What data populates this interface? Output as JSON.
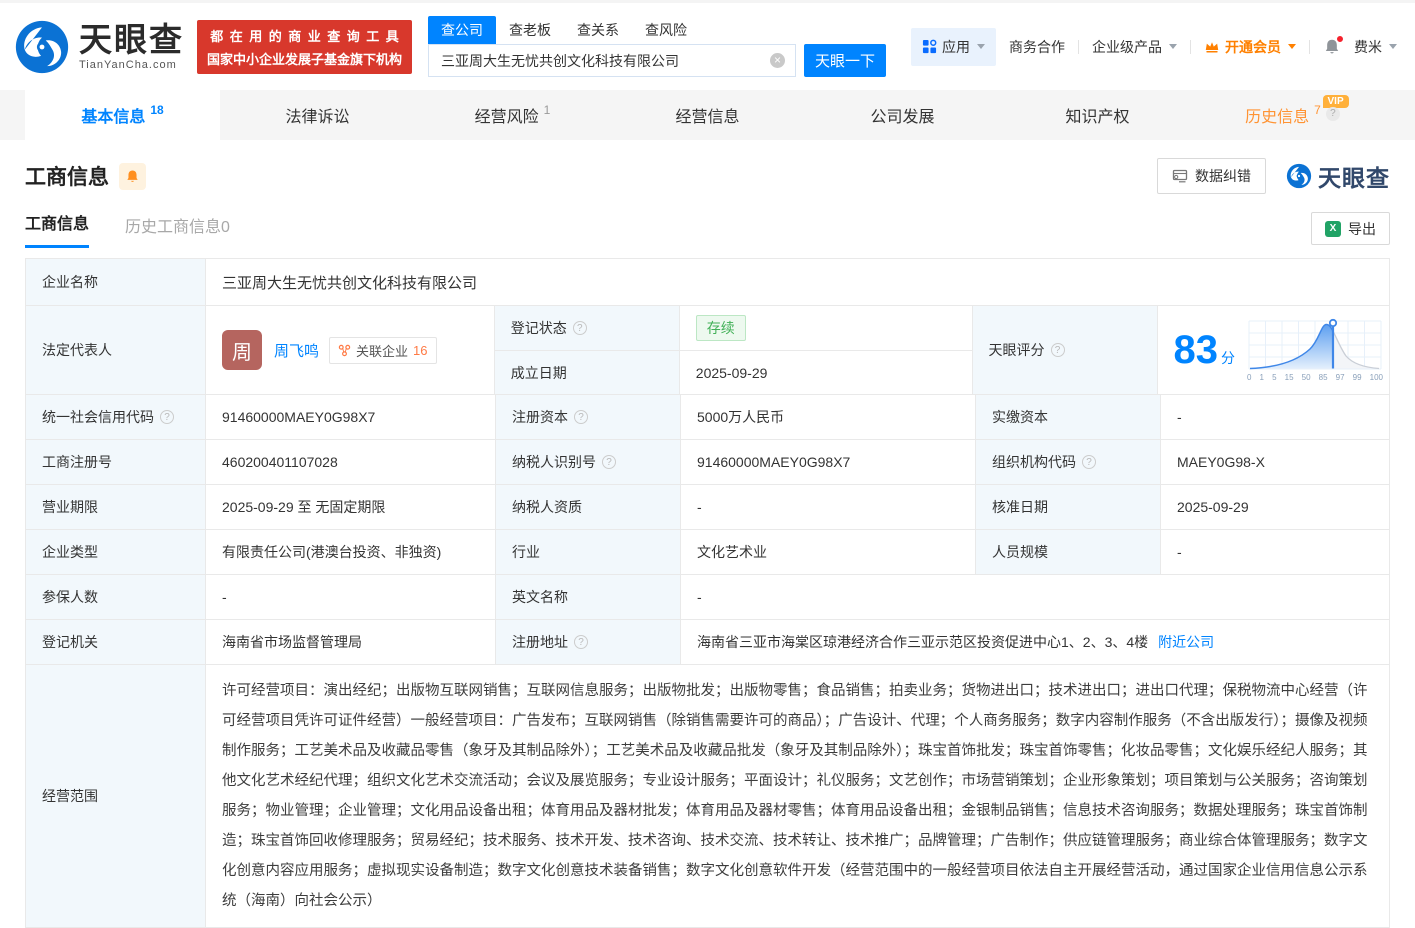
{
  "header": {
    "logo_title": "天眼查",
    "logo_sub": "TianYanCha.com",
    "promo_line1": "都在用的商业查询工具",
    "promo_line2": "国家中小企业发展子基金旗下机构",
    "search_tabs": [
      {
        "label": "查公司"
      },
      {
        "label": "查老板"
      },
      {
        "label": "查关系"
      },
      {
        "label": "查风险"
      }
    ],
    "search_value": "三亚周大生无忧共创文化科技有限公司",
    "search_button": "天眼一下",
    "nav_apps": "应用",
    "nav_cooperation": "商务合作",
    "nav_enterprise": "企业级产品",
    "nav_vip": "开通会员",
    "nav_user": "费米"
  },
  "tabs": [
    {
      "label": "基本信息",
      "count": "18"
    },
    {
      "label": "法律诉讼",
      "count": ""
    },
    {
      "label": "经营风险",
      "count": "1"
    },
    {
      "label": "经营信息",
      "count": ""
    },
    {
      "label": "公司发展",
      "count": ""
    },
    {
      "label": "知识产权",
      "count": ""
    },
    {
      "label": "历史信息",
      "count": "7",
      "vip": "VIP"
    }
  ],
  "section": {
    "title": "工商信息",
    "subtab_active": "工商信息",
    "subtab_history": "历史工商信息0",
    "correction_btn": "数据纠错",
    "watermark": "天眼查",
    "export_btn": "导出"
  },
  "info": {
    "company_name_label": "企业名称",
    "company_name": "三亚周大生无忧共创文化科技有限公司",
    "legal_rep_label": "法定代表人",
    "legal_rep_avatar": "周",
    "legal_rep_name": "周飞鸣",
    "related_badge": "关联企业",
    "related_count": "16",
    "reg_status_label": "登记状态",
    "reg_status": "存续",
    "est_date_label": "成立日期",
    "est_date": "2025-09-29",
    "score_label": "天眼评分",
    "score_value": "83",
    "score_unit": "分",
    "score_axis": [
      "0",
      "1",
      "5",
      "15",
      "50",
      "85",
      "97",
      "99",
      "100"
    ],
    "rows": [
      {
        "cells": [
          {
            "label": "统一社会信用代码",
            "value": "91460000MAEY0G98X7"
          },
          {
            "label": "注册资本",
            "value": "5000万人民币"
          },
          {
            "label": "实缴资本",
            "value": "-"
          }
        ]
      },
      {
        "cells": [
          {
            "label": "工商注册号",
            "value": "460200401107028"
          },
          {
            "label": "纳税人识别号",
            "value": "91460000MAEY0G98X7"
          },
          {
            "label": "组织机构代码",
            "value": "MAEY0G98-X"
          }
        ]
      },
      {
        "cells": [
          {
            "label": "营业期限",
            "value": "2025-09-29 至 无固定期限"
          },
          {
            "label": "纳税人资质",
            "value": "-"
          },
          {
            "label": "核准日期",
            "value": "2025-09-29"
          }
        ]
      },
      {
        "cells": [
          {
            "label": "企业类型",
            "value": "有限责任公司(港澳台投资、非独资)"
          },
          {
            "label": "行业",
            "value": "文化艺术业"
          },
          {
            "label": "人员规模",
            "value": "-"
          }
        ]
      }
    ],
    "insured_label": "参保人数",
    "insured_value": "-",
    "en_name_label": "英文名称",
    "en_name_value": "-",
    "authority_label": "登记机关",
    "authority_value": "海南省市场监督管理局",
    "address_label": "注册地址",
    "address_value": "海南省三亚市海棠区琼港经济合作三亚示范区投资促进中心1、2、3、4楼",
    "address_link": "附近公司",
    "scope_label": "经营范围",
    "scope_value": "许可经营项目：演出经纪；出版物互联网销售；互联网信息服务；出版物批发；出版物零售；食品销售；拍卖业务；货物进出口；技术进出口；进出口代理；保税物流中心经营（许可经营项目凭许可证件经营）一般经营项目：广告发布；互联网销售（除销售需要许可的商品）；广告设计、代理；个人商务服务；数字内容制作服务（不含出版发行）；摄像及视频制作服务；工艺美术品及收藏品零售（象牙及其制品除外）；工艺美术品及收藏品批发（象牙及其制品除外）；珠宝首饰批发；珠宝首饰零售；化妆品零售；文化娱乐经纪人服务；其他文化艺术经纪代理；组织文化艺术交流活动；会议及展览服务；专业设计服务；平面设计；礼仪服务；文艺创作；市场营销策划；企业形象策划；项目策划与公关服务；咨询策划服务；物业管理；企业管理；文化用品设备出租；体育用品及器材批发；体育用品及器材零售；体育用品设备出租；金银制品销售；信息技术咨询服务；数据处理服务；珠宝首饰制造；珠宝首饰回收修理服务；贸易经纪；技术服务、技术开发、技术咨询、技术交流、技术转让、技术推广；品牌管理；广告制作；供应链管理服务；商业综合体管理服务；数字文化创意内容应用服务；虚拟现实设备制造；数字文化创意技术装备销售；数字文化创意软件开发（经营范围中的一般经营项目依法自主开展经营活动，通过国家企业信用信息公示系统（海南）向社会公示）"
  }
}
